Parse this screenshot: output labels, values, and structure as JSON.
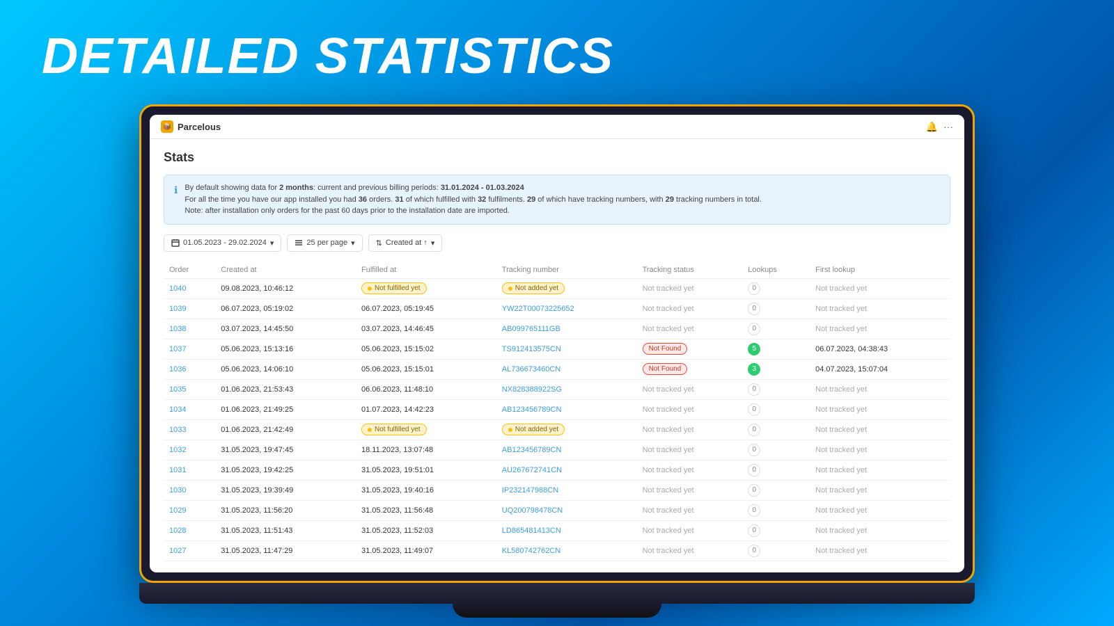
{
  "page": {
    "title": "DETAILED STATISTICS"
  },
  "app": {
    "name": "Parcelous",
    "stats_label": "Stats",
    "bell_icon": "🔔",
    "more_icon": "···"
  },
  "info_banner": {
    "line1_prefix": "By default showing data for ",
    "bold1": "2 months",
    "line1_mid": ": current and previous billing periods: ",
    "bold2": "31.01.2024 - 01.03.2024",
    "line2_prefix": "For all the time you have our app installed you had ",
    "bold3": "36",
    "line2_mid1": " orders. ",
    "bold4": "31",
    "line2_mid2": " of which fulfilled with ",
    "bold5": "32",
    "line2_mid3": " fulfilments. ",
    "bold6": "29",
    "line2_mid4": " of which have tracking numbers, with ",
    "bold7": "29",
    "line2_end": " tracking numbers in total.",
    "line3": "Note: after installation only orders for the past 60 days prior to the installation date are imported."
  },
  "filters": {
    "date_range": "01.05.2023 - 29.02.2024",
    "per_page": "25 per page",
    "sort": "Created at ↑"
  },
  "table": {
    "headers": [
      "Order",
      "Created at",
      "Fulfilled at",
      "Tracking number",
      "Tracking status",
      "Lookups",
      "First lookup"
    ],
    "rows": [
      {
        "order": "1040",
        "created_at": "09.08.2023, 10:46:12",
        "fulfilled_at_badge": "Not fulfilled yet",
        "fulfilled_at_badge_type": "yellow",
        "tracking_number": "Not added yet",
        "tracking_number_type": "badge_yellow",
        "tracking_status": "Not tracked yet",
        "lookups": "0",
        "first_lookup": "Not tracked yet"
      },
      {
        "order": "1039",
        "created_at": "06.07.2023, 05:19:02",
        "fulfilled_at": "06.07.2023, 05:19:45",
        "tracking_number": "YW22T00073225652",
        "tracking_number_type": "link",
        "tracking_status": "Not tracked yet",
        "lookups": "0",
        "first_lookup": "Not tracked yet"
      },
      {
        "order": "1038",
        "created_at": "03.07.2023, 14:45:50",
        "fulfilled_at": "03.07.2023, 14:46:45",
        "tracking_number": "AB099765111GB",
        "tracking_number_type": "link",
        "tracking_status": "Not tracked yet",
        "lookups": "0",
        "first_lookup": "Not tracked yet"
      },
      {
        "order": "1037",
        "created_at": "05.06.2023, 15:13:16",
        "fulfilled_at": "05.06.2023, 15:15:02",
        "tracking_number": "TS912413575CN",
        "tracking_number_type": "link",
        "tracking_status": "Not Found",
        "tracking_status_type": "orange",
        "lookups": "5",
        "lookups_type": "green",
        "first_lookup": "06.07.2023, 04:38:43"
      },
      {
        "order": "1036",
        "created_at": "05.06.2023, 14:06:10",
        "fulfilled_at": "05.06.2023, 15:15:01",
        "tracking_number": "AL736673460CN",
        "tracking_number_type": "link",
        "tracking_status": "Not Found",
        "tracking_status_type": "orange",
        "lookups": "3",
        "lookups_type": "green",
        "first_lookup": "04.07.2023, 15:07:04"
      },
      {
        "order": "1035",
        "created_at": "01.06.2023, 21:53:43",
        "fulfilled_at": "06.06.2023, 11:48:10",
        "tracking_number": "NX828388922SG",
        "tracking_number_type": "link",
        "tracking_status": "Not tracked yet",
        "lookups": "0",
        "first_lookup": "Not tracked yet"
      },
      {
        "order": "1034",
        "created_at": "01.06.2023, 21:49:25",
        "fulfilled_at": "01.07.2023, 14:42:23",
        "tracking_number": "AB123456789CN",
        "tracking_number_type": "link",
        "tracking_status": "Not tracked yet",
        "lookups": "0",
        "first_lookup": "Not tracked yet"
      },
      {
        "order": "1033",
        "created_at": "01.06.2023, 21:42:49",
        "fulfilled_at_badge": "Not fulfilled yet",
        "fulfilled_at_badge_type": "yellow",
        "tracking_number": "Not added yet",
        "tracking_number_type": "badge_yellow",
        "tracking_status": "Not tracked yet",
        "lookups": "0",
        "first_lookup": "Not tracked yet"
      },
      {
        "order": "1032",
        "created_at": "31.05.2023, 19:47:45",
        "fulfilled_at": "18.11.2023, 13:07:48",
        "tracking_number": "AB123456789CN",
        "tracking_number_type": "link",
        "tracking_status": "Not tracked yet",
        "lookups": "0",
        "first_lookup": "Not tracked yet"
      },
      {
        "order": "1031",
        "created_at": "31.05.2023, 19:42:25",
        "fulfilled_at": "31.05.2023, 19:51:01",
        "tracking_number": "AU267672741CN",
        "tracking_number_type": "link",
        "tracking_status": "Not tracked yet",
        "lookups": "0",
        "first_lookup": "Not tracked yet"
      },
      {
        "order": "1030",
        "created_at": "31.05.2023, 19:39:49",
        "fulfilled_at": "31.05.2023, 19:40:16",
        "tracking_number": "IP232147988CN",
        "tracking_number_type": "link",
        "tracking_status": "Not tracked yet",
        "lookups": "0",
        "first_lookup": "Not tracked yet"
      },
      {
        "order": "1029",
        "created_at": "31.05.2023, 11:56:20",
        "fulfilled_at": "31.05.2023, 11:56:48",
        "tracking_number": "UQ200798478CN",
        "tracking_number_type": "link",
        "tracking_status": "Not tracked yet",
        "lookups": "0",
        "first_lookup": "Not tracked yet"
      },
      {
        "order": "1028",
        "created_at": "31.05.2023, 11:51:43",
        "fulfilled_at": "31.05.2023, 11:52:03",
        "tracking_number": "LD865481413CN",
        "tracking_number_type": "link",
        "tracking_status": "Not tracked yet",
        "lookups": "0",
        "first_lookup": "Not tracked yet"
      },
      {
        "order": "1027",
        "created_at": "31.05.2023, 11:47:29",
        "fulfilled_at": "31.05.2023, 11:49:07",
        "tracking_number": "KL580742762CN",
        "tracking_number_type": "link",
        "tracking_status": "Not tracked yet",
        "lookups": "0",
        "first_lookup": "Not tracked yet"
      }
    ]
  }
}
